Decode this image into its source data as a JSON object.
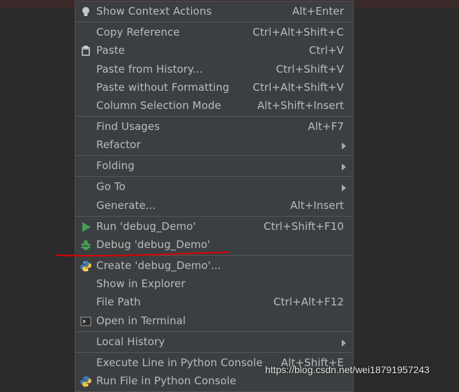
{
  "menu": {
    "items": [
      {
        "label": "Show Context Actions",
        "shortcut": "Alt+Enter",
        "icon": "bulb-icon"
      },
      {
        "label": "Copy Reference",
        "shortcut": "Ctrl+Alt+Shift+C"
      },
      {
        "label": "Paste",
        "shortcut": "Ctrl+V",
        "icon": "clipboard-icon"
      },
      {
        "label": "Paste from History...",
        "shortcut": "Ctrl+Shift+V"
      },
      {
        "label": "Paste without Formatting",
        "shortcut": "Ctrl+Alt+Shift+V"
      },
      {
        "label": "Column Selection Mode",
        "shortcut": "Alt+Shift+Insert"
      },
      {
        "label": "Find Usages",
        "shortcut": "Alt+F7"
      },
      {
        "label": "Refactor",
        "shortcut": "",
        "submenu": true
      },
      {
        "label": "Folding",
        "shortcut": "",
        "submenu": true
      },
      {
        "label": "Go To",
        "shortcut": "",
        "submenu": true
      },
      {
        "label": "Generate...",
        "shortcut": "Alt+Insert"
      },
      {
        "label": "Run 'debug_Demo'",
        "shortcut": "Ctrl+Shift+F10",
        "icon": "run-icon"
      },
      {
        "label": "Debug 'debug_Demo'",
        "shortcut": "",
        "icon": "debug-bug-icon"
      },
      {
        "label": "Create 'debug_Demo'...",
        "shortcut": "",
        "icon": "python-icon"
      },
      {
        "label": "Show in Explorer",
        "shortcut": ""
      },
      {
        "label": "File Path",
        "shortcut": "Ctrl+Alt+F12"
      },
      {
        "label": "Open in Terminal",
        "shortcut": "",
        "icon": "terminal-icon"
      },
      {
        "label": "Local History",
        "shortcut": "",
        "submenu": true
      },
      {
        "label": "Execute Line in Python Console",
        "shortcut": "Alt+Shift+E"
      },
      {
        "label": "Run File in Python Console",
        "shortcut": "",
        "icon": "python-icon"
      }
    ]
  },
  "watermark": "https://blog.csdn.net/wei18791957243",
  "colors": {
    "menu_bg": "#3c3f41",
    "text": "#bbbbbb",
    "run_green": "#499c54",
    "annotation_red": "#e00000"
  }
}
